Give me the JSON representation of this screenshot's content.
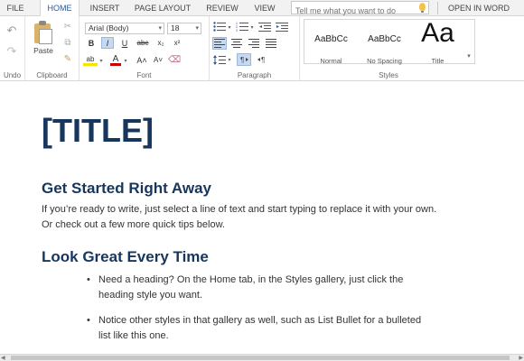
{
  "tabs": {
    "file": "FILE",
    "home": "HOME",
    "insert": "INSERT",
    "page_layout": "PAGE LAYOUT",
    "review": "REVIEW",
    "view": "VIEW",
    "tell_me_placeholder": "Tell me what you want to do",
    "open_in_word": "OPEN IN WORD"
  },
  "ribbon": {
    "groups": {
      "undo": "Undo",
      "clipboard": "Clipboard",
      "font": "Font",
      "paragraph": "Paragraph",
      "styles": "Styles"
    },
    "paste_label": "Paste",
    "font_name": "Arial (Body)",
    "font_size": "18",
    "format_buttons": {
      "bold": "B",
      "italic": "I",
      "underline": "U",
      "strike": "abc",
      "subscript": "x₂",
      "superscript": "x²",
      "highlight": "ab",
      "font_color": "A",
      "grow": "A˄",
      "shrink": "A˅"
    },
    "styles": [
      {
        "preview": "AaBbCc",
        "name": "Normal"
      },
      {
        "preview": "AaBbCc",
        "name": "No Spacing"
      },
      {
        "preview": "Aa",
        "name": "Title"
      }
    ]
  },
  "document": {
    "title": "[TITLE]",
    "heading1": "Get Started Right Away",
    "para1": "If you’re ready to write, just select a line of text and start typing to replace it with your own. Or check out a few more quick tips below.",
    "heading2": "Look Great Every Time",
    "bullets": [
      "Need a heading? On the Home tab, in the Styles gallery, just click the heading style you want.",
      "Notice other styles in that gallery as well, such as List Bullet for a bulleted list like this one."
    ]
  },
  "colors": {
    "accent": "#2b579a",
    "heading": "#17365d",
    "body_text": "#333333"
  }
}
